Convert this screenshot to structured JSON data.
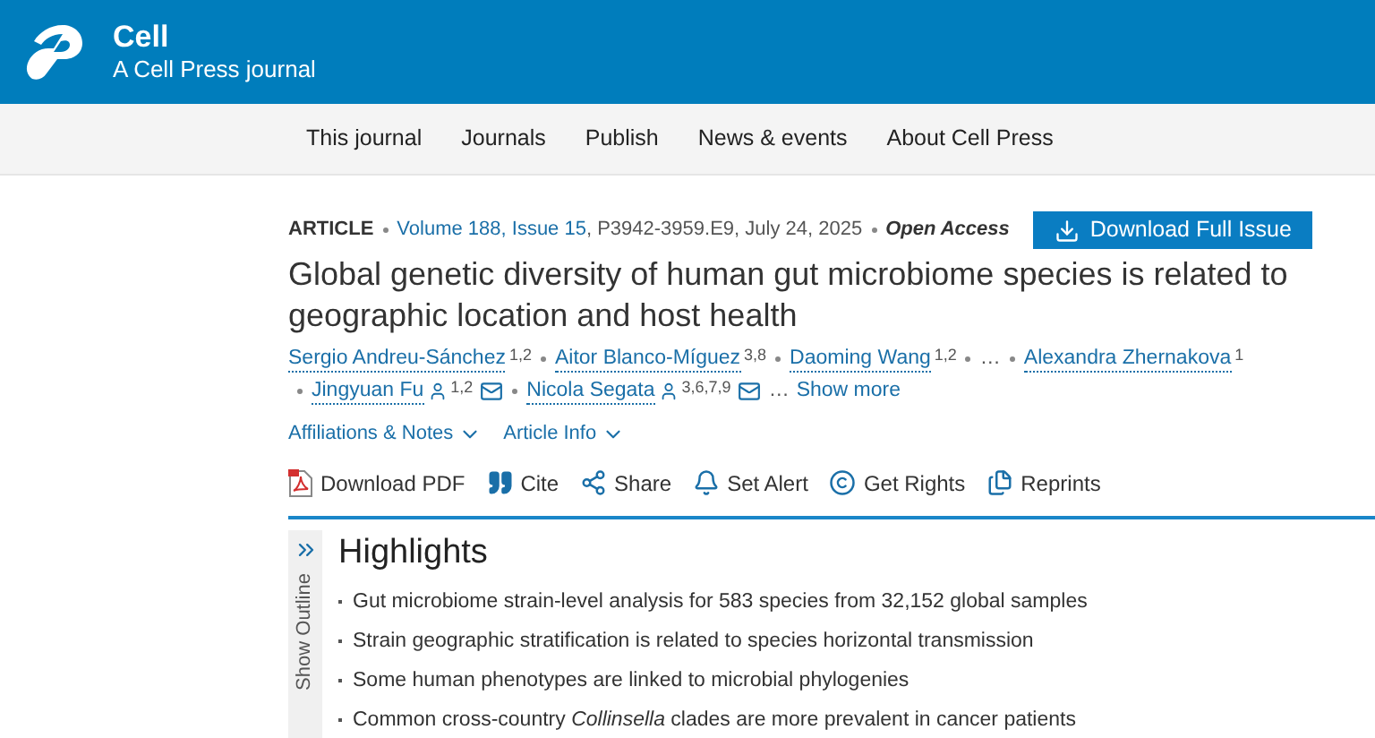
{
  "header": {
    "brand": "Cell",
    "tagline": "A Cell Press journal"
  },
  "nav": [
    "This journal",
    "Journals",
    "Publish",
    "News & events",
    "About Cell Press"
  ],
  "meta": {
    "type": "ARTICLE",
    "volume": "Volume 188, Issue 15",
    "pages": ", P3942-3959.E9, July 24, 2025",
    "access": "Open Access",
    "download_button": "Download Full Issue"
  },
  "title": "Global genetic diversity of human gut microbiome species is related to geographic location and host health",
  "authors": [
    {
      "kind": "author",
      "name": "Sergio Andreu-Sánchez",
      "affiliations": "1,2",
      "corresponding": false
    },
    {
      "kind": "author",
      "name": "Aitor Blanco-Míguez",
      "affiliations": "3,8",
      "corresponding": false
    },
    {
      "kind": "author",
      "name": "Daoming Wang",
      "affiliations": "1,2",
      "corresponding": false
    },
    {
      "kind": "ellipsis",
      "name": "…"
    },
    {
      "kind": "author",
      "name": "Alexandra Zhernakova",
      "affiliations": "1",
      "corresponding": false
    },
    {
      "kind": "author",
      "name": "Jingyuan Fu",
      "affiliations": "1,2",
      "corresponding": true
    },
    {
      "kind": "author",
      "name": "Nicola Segata",
      "affiliations": "3,6,7,9",
      "corresponding": true
    }
  ],
  "show_more": {
    "ellipsis": "…",
    "label": "Show more"
  },
  "info_toggles": [
    "Affiliations & Notes",
    "Article Info"
  ],
  "tools": [
    {
      "kind": "pdf",
      "label": "Download PDF"
    },
    {
      "kind": "cite",
      "label": "Cite"
    },
    {
      "kind": "share",
      "label": "Share"
    },
    {
      "kind": "alert",
      "label": "Set Alert"
    },
    {
      "kind": "rights",
      "label": "Get Rights"
    },
    {
      "kind": "reprints",
      "label": "Reprints"
    }
  ],
  "outline_toggle": "Show Outline",
  "highlights": {
    "heading": "Highlights",
    "items": [
      "Gut microbiome strain-level analysis for 583 species from 32,152 global samples",
      "Strain geographic stratification is related to species horizontal transmission",
      "Some human phenotypes are linked to microbial phylogenies",
      "Common cross-country *Collinsella* clades are more prevalent in cancer patients"
    ]
  }
}
